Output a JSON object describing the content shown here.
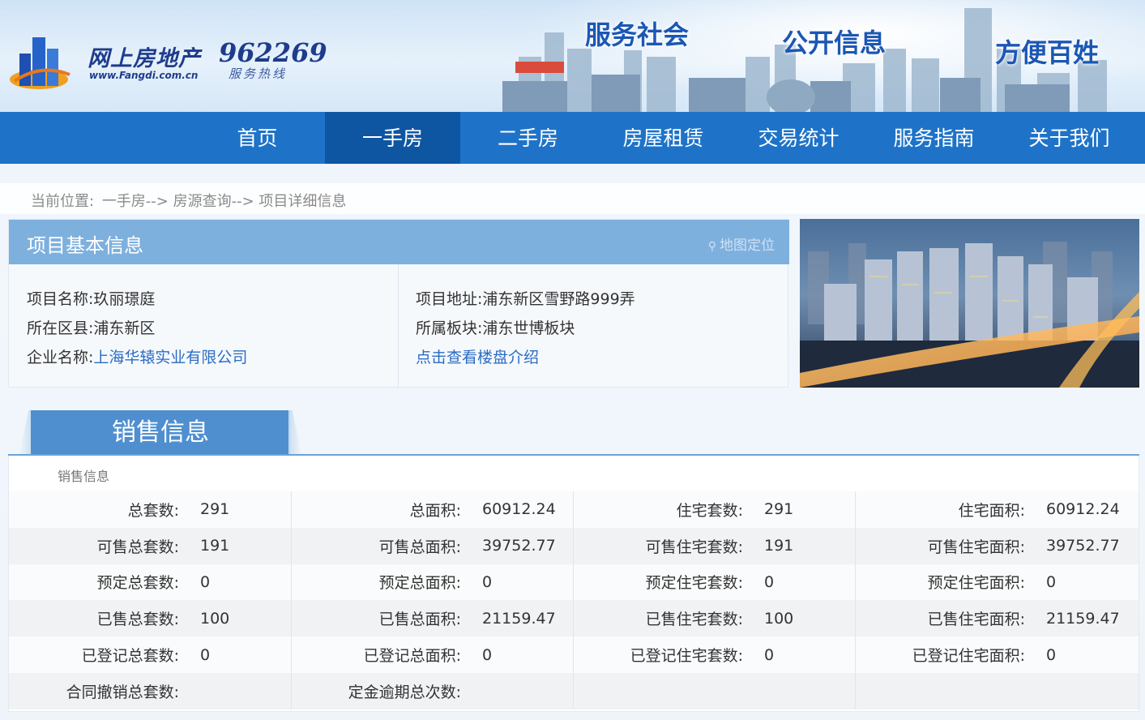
{
  "banner": {
    "logo_text": "网上房地产",
    "logo_url": "www.Fangdi.com.cn",
    "hotline_number": "962269",
    "hotline_label": "服务热线",
    "slogans": [
      "服务社会",
      "公开信息",
      "方便百姓"
    ]
  },
  "nav": {
    "items": [
      {
        "label": "首页"
      },
      {
        "label": "一手房"
      },
      {
        "label": "二手房"
      },
      {
        "label": "房屋租赁"
      },
      {
        "label": "交易统计"
      },
      {
        "label": "服务指南"
      },
      {
        "label": "关于我们"
      }
    ],
    "active_index": 1
  },
  "breadcrumb": {
    "prefix": "当前位置:",
    "path": "一手房--> 房源查询--> 项目详细信息"
  },
  "project": {
    "header": "项目基本信息",
    "map_link": "地图定位",
    "name_label": "项目名称:",
    "name": "玖丽璟庭",
    "district_label": "所在区县:",
    "district": "浦东新区",
    "company_label": "企业名称:",
    "company": "上海华辕实业有限公司",
    "address_label": "项目地址:",
    "address": "浦东新区雪野路999弄",
    "block_label": "所属板块:",
    "block": "浦东世博板块",
    "intro_link": "点击查看楼盘介绍"
  },
  "sales": {
    "tab_title": "销售信息",
    "sub_title": "销售信息",
    "rows": [
      [
        {
          "label": "总套数:",
          "value": "291"
        },
        {
          "label": "总面积:",
          "value": "60912.24"
        },
        {
          "label": "住宅套数:",
          "value": "291"
        },
        {
          "label": "住宅面积:",
          "value": "60912.24"
        }
      ],
      [
        {
          "label": "可售总套数:",
          "value": "191"
        },
        {
          "label": "可售总面积:",
          "value": "39752.77"
        },
        {
          "label": "可售住宅套数:",
          "value": "191"
        },
        {
          "label": "可售住宅面积:",
          "value": "39752.77"
        }
      ],
      [
        {
          "label": "预定总套数:",
          "value": "0"
        },
        {
          "label": "预定总面积:",
          "value": "0"
        },
        {
          "label": "预定住宅套数:",
          "value": "0"
        },
        {
          "label": "预定住宅面积:",
          "value": "0"
        }
      ],
      [
        {
          "label": "已售总套数:",
          "value": "100"
        },
        {
          "label": "已售总面积:",
          "value": "21159.47"
        },
        {
          "label": "已售住宅套数:",
          "value": "100"
        },
        {
          "label": "已售住宅面积:",
          "value": "21159.47"
        }
      ],
      [
        {
          "label": "已登记总套数:",
          "value": "0"
        },
        {
          "label": "已登记总面积:",
          "value": "0"
        },
        {
          "label": "已登记住宅套数:",
          "value": "0"
        },
        {
          "label": "已登记住宅面积:",
          "value": "0"
        }
      ],
      [
        {
          "label": "合同撤销总套数:",
          "value": ""
        },
        {
          "label": "定金逾期总次数:",
          "value": ""
        },
        {
          "label": "",
          "value": ""
        },
        {
          "label": "",
          "value": ""
        }
      ]
    ]
  },
  "colors": {
    "nav_bg": "#1e73c8",
    "nav_active": "#0f56a2",
    "header_bar": "#7eb0de",
    "link": "#2a6cc4"
  }
}
